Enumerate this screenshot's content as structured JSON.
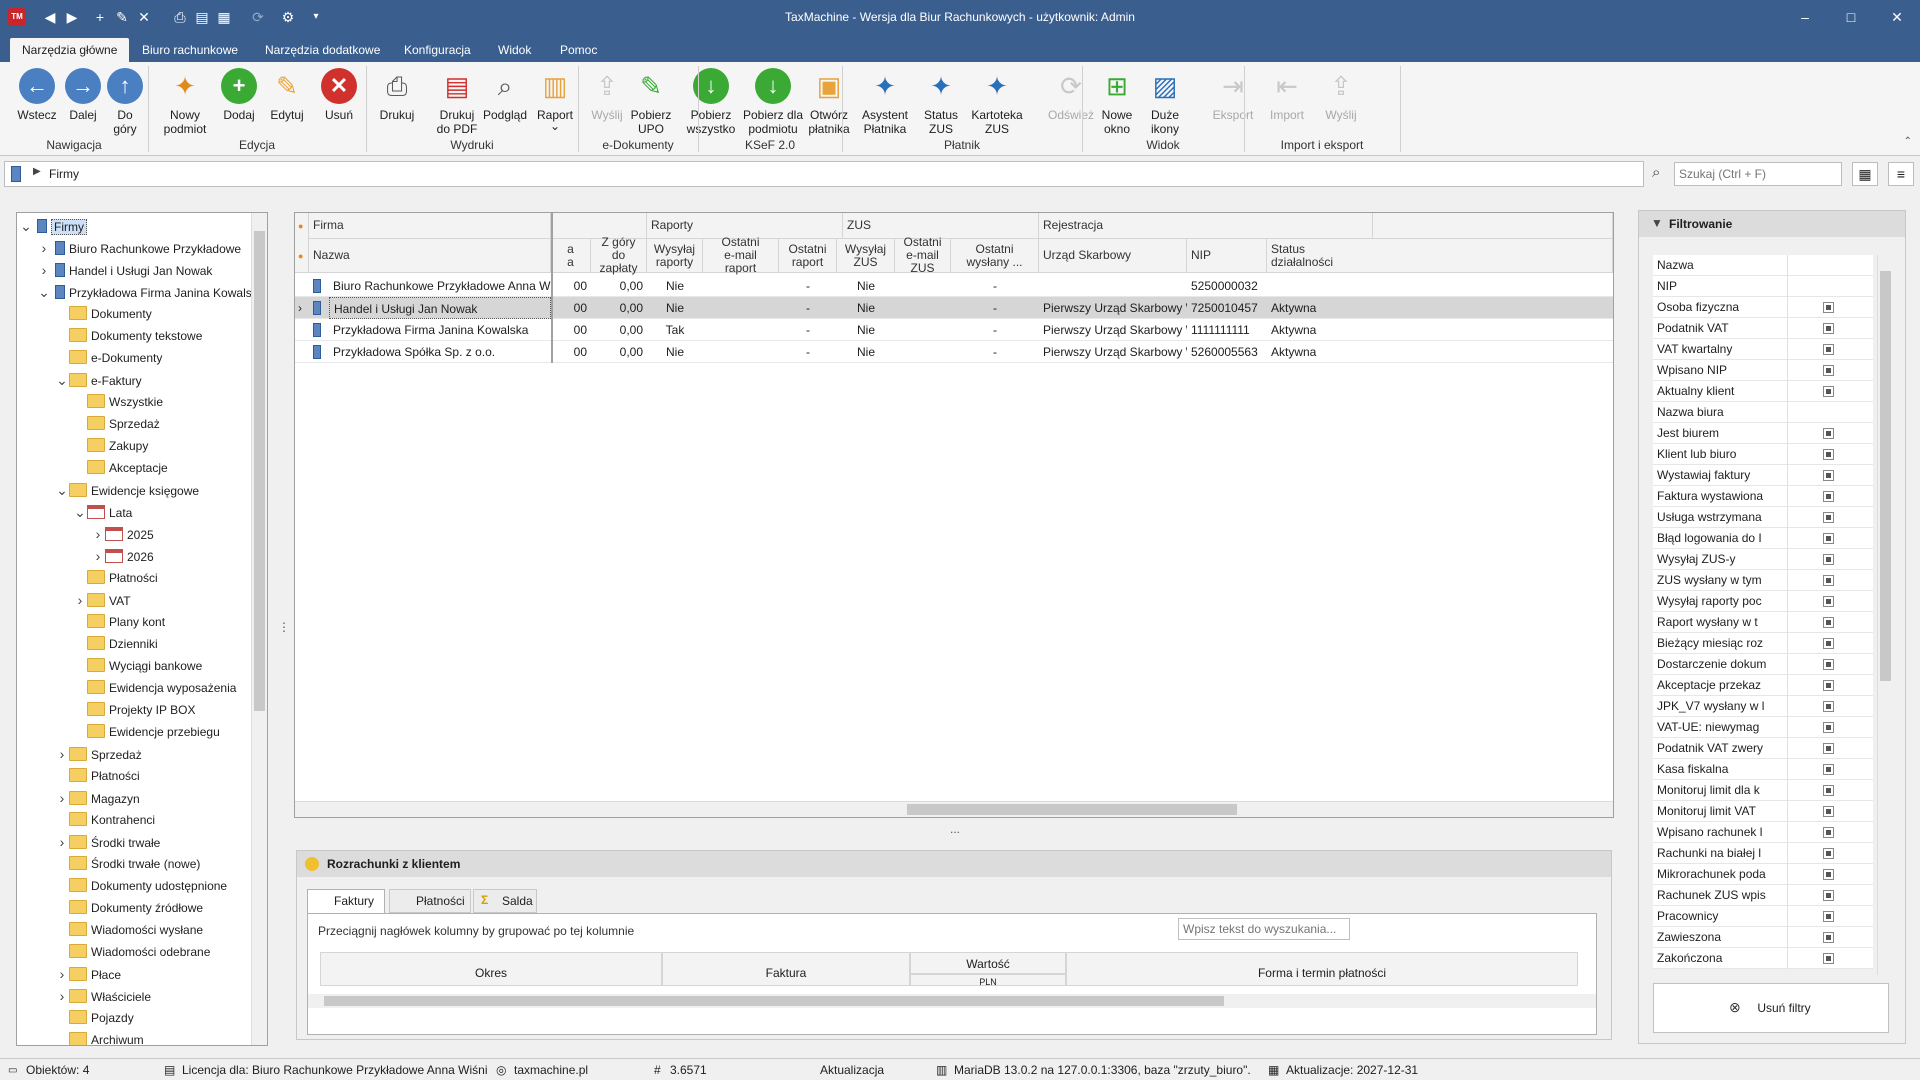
{
  "window": {
    "title": "TaxMachine  -  Wersja dla Biur Rachunkowych - użytkownik: Admin",
    "app_icon_text": "TM"
  },
  "ribbon_tabs": [
    "Narzędzia główne",
    "Biuro rachunkowe",
    "Narzędzia dodatkowe",
    "Konfiguracja",
    "Widok",
    "Pomoc"
  ],
  "ribbon": {
    "buttons": [
      {
        "label": "Wstecz",
        "icon": "arrow-left-icon",
        "color": "#4a7fc1"
      },
      {
        "label": "Dalej",
        "icon": "arrow-right-icon",
        "color": "#4a7fc1"
      },
      {
        "label": "Do\ngóry",
        "icon": "arrow-up-icon",
        "color": "#4a7fc1"
      },
      {
        "label": "Nowy\npodmiot",
        "icon": "magic-wand-icon"
      },
      {
        "label": "Dodaj",
        "icon": "plus-icon",
        "color": "#3aaa35"
      },
      {
        "label": "Edytuj",
        "icon": "pencil-icon"
      },
      {
        "label": "Usuń",
        "icon": "delete-x-icon",
        "color": "#d0312d"
      },
      {
        "label": "Drukuj",
        "icon": "printer-icon"
      },
      {
        "label": "Drukuj\ndo PDF",
        "icon": "pdf-icon"
      },
      {
        "label": "Podgląd",
        "icon": "preview-icon"
      },
      {
        "label": "Raport",
        "icon": "report-icon"
      },
      {
        "label": "Wyślij",
        "icon": "send-icon",
        "disabled": true
      },
      {
        "label": "Pobierz\nUPO",
        "icon": "upo-icon"
      },
      {
        "label": "Pobierz\nwszystko",
        "icon": "download-all-icon",
        "color": "#3aaa35"
      },
      {
        "label": "Pobierz dla\npodmiotu",
        "icon": "download-entity-icon",
        "color": "#3aaa35"
      },
      {
        "label": "Otwórz\npłatnika",
        "icon": "open-folder-icon"
      },
      {
        "label": "Asystent\nPłatnika",
        "icon": "wizard-icon"
      },
      {
        "label": "Status\nZUS",
        "icon": "status-zus-icon"
      },
      {
        "label": "Kartoteka\nZUS",
        "icon": "kartoteka-zus-icon"
      },
      {
        "label": "Odśwież",
        "icon": "refresh-icon",
        "disabled": true
      },
      {
        "label": "Nowe\nokno",
        "icon": "new-window-icon"
      },
      {
        "label": "Duże\nikony",
        "icon": "large-icons-icon"
      },
      {
        "label": "Eksport",
        "icon": "export-icon",
        "disabled": true
      },
      {
        "label": "Import",
        "icon": "import-icon",
        "disabled": true
      },
      {
        "label": "Wyślij",
        "icon": "send-icon",
        "disabled": true
      }
    ],
    "groups": [
      "Nawigacja",
      "Edycja",
      "Wydruki",
      "e-Dokumenty",
      "KSeF 2.0",
      "Płatnik",
      "Widok",
      "Import i eksport"
    ]
  },
  "breadcrumb": {
    "item": "Firmy"
  },
  "search": {
    "placeholder": "Szukaj (Ctrl + F)"
  },
  "tree": [
    {
      "label": "Firmy",
      "level": 0,
      "icon": "bldg",
      "exp": "v",
      "sel": true
    },
    {
      "label": "Biuro Rachunkowe Przykładowe",
      "level": 1,
      "icon": "bldg",
      "exp": ">"
    },
    {
      "label": "Handel i Usługi Jan Nowak",
      "level": 1,
      "icon": "bldg",
      "exp": ">"
    },
    {
      "label": "Przykładowa Firma Janina Kowalska",
      "level": 1,
      "icon": "bldg",
      "exp": "v"
    },
    {
      "label": "Dokumenty",
      "level": 2,
      "icon": "folder"
    },
    {
      "label": "Dokumenty tekstowe",
      "level": 2,
      "icon": "folder"
    },
    {
      "label": "e-Dokumenty",
      "level": 2,
      "icon": "folder"
    },
    {
      "label": "e-Faktury",
      "level": 2,
      "icon": "folder",
      "exp": "v"
    },
    {
      "label": "Wszystkie",
      "level": 3,
      "icon": "folder"
    },
    {
      "label": "Sprzedaż",
      "level": 3,
      "icon": "folder"
    },
    {
      "label": "Zakupy",
      "level": 3,
      "icon": "folder"
    },
    {
      "label": "Akceptacje",
      "level": 3,
      "icon": "folder"
    },
    {
      "label": "Ewidencje księgowe",
      "level": 2,
      "icon": "folder",
      "exp": "v"
    },
    {
      "label": "Lata",
      "level": 3,
      "icon": "cal",
      "exp": "v"
    },
    {
      "label": "2025",
      "level": 4,
      "icon": "cal",
      "exp": ">"
    },
    {
      "label": "2026",
      "level": 4,
      "icon": "cal",
      "exp": ">"
    },
    {
      "label": "Płatności",
      "level": 3,
      "icon": "folder"
    },
    {
      "label": "VAT",
      "level": 3,
      "icon": "folder",
      "exp": ">"
    },
    {
      "label": "Plany kont",
      "level": 3,
      "icon": "folder"
    },
    {
      "label": "Dzienniki",
      "level": 3,
      "icon": "folder"
    },
    {
      "label": "Wyciągi bankowe",
      "level": 3,
      "icon": "folder"
    },
    {
      "label": "Ewidencja wyposażenia",
      "level": 3,
      "icon": "folder"
    },
    {
      "label": "Projekty IP BOX",
      "level": 3,
      "icon": "folder"
    },
    {
      "label": "Ewidencje przebiegu",
      "level": 3,
      "icon": "folder"
    },
    {
      "label": "Sprzedaż",
      "level": 2,
      "icon": "folder",
      "exp": ">"
    },
    {
      "label": "Płatności",
      "level": 2,
      "icon": "folder"
    },
    {
      "label": "Magazyn",
      "level": 2,
      "icon": "folder",
      "exp": ">"
    },
    {
      "label": "Kontrahenci",
      "level": 2,
      "icon": "folder"
    },
    {
      "label": "Środki trwałe",
      "level": 2,
      "icon": "folder",
      "exp": ">"
    },
    {
      "label": "Środki trwałe (nowe)",
      "level": 2,
      "icon": "folder"
    },
    {
      "label": "Dokumenty udostępnione",
      "level": 2,
      "icon": "folder"
    },
    {
      "label": "Dokumenty źródłowe",
      "level": 2,
      "icon": "folder"
    },
    {
      "label": "Wiadomości wysłane",
      "level": 2,
      "icon": "folder"
    },
    {
      "label": "Wiadomości odebrane",
      "level": 2,
      "icon": "folder"
    },
    {
      "label": "Płace",
      "level": 2,
      "icon": "folder",
      "exp": ">"
    },
    {
      "label": "Właściciele",
      "level": 2,
      "icon": "folder",
      "exp": ">"
    },
    {
      "label": "Pojazdy",
      "level": 2,
      "icon": "folder"
    },
    {
      "label": "Archiwum",
      "level": 2,
      "icon": "folder"
    }
  ],
  "grid": {
    "groups": [
      "Firma",
      "Raporty",
      "ZUS",
      "Rejestracja"
    ],
    "columns": [
      "Nazwa",
      "a\na",
      "Z góry\ndo zapłaty",
      "Wysyłaj\nraporty",
      "Ostatni\ne-mail raport",
      "Ostatni\nraport",
      "Wysyłaj\nZUS",
      "Ostatni\ne-mail ZUS",
      "Ostatni\nwysłany ...",
      "Urząd Skarbowy",
      "NIP",
      "Status\ndziałalności"
    ],
    "rows": [
      [
        "Biuro Rachunkowe Przykładowe Anna Wiśnie...",
        "00",
        "0,00",
        "Nie",
        "",
        "-",
        "Nie",
        "",
        "-",
        "",
        "5250000032",
        ""
      ],
      [
        "Handel i Usługi Jan Nowak",
        "00",
        "0,00",
        "Nie",
        "",
        "-",
        "Nie",
        "",
        "-",
        "Pierwszy Urząd Skarbowy W...",
        "7250010457",
        "Aktywna"
      ],
      [
        "Przykładowa Firma Janina Kowalska",
        "00",
        "0,00",
        "Tak",
        "",
        "-",
        "Nie",
        "",
        "-",
        "Pierwszy Urząd Skarbowy W...",
        "1111111111",
        "Aktywna"
      ],
      [
        "Przykładowa Spółka Sp. z o.o.",
        "00",
        "0,00",
        "Nie",
        "",
        "-",
        "Nie",
        "",
        "-",
        "Pierwszy Urząd Skarbowy W...",
        "5260005563",
        "Aktywna"
      ]
    ],
    "selected_row": 1
  },
  "splitter_handle": "...",
  "bottom_panel": {
    "title": "Rozrachunki z klientem",
    "tabs": [
      "Faktury",
      "Płatności",
      "Salda"
    ],
    "group_hint": "Przeciągnij nagłówek kolumny by grupować po tej kolumnie",
    "search_placeholder": "Wpisz tekst do wyszukania...",
    "columns": [
      "Okres",
      "Faktura",
      "Wartość",
      "PLN",
      "Forma i termin płatności"
    ]
  },
  "filter": {
    "title": "Filtrowanie",
    "rows": [
      {
        "label": "Nazwa",
        "cb": false
      },
      {
        "label": "NIP",
        "cb": false
      },
      {
        "label": "Osoba fizyczna",
        "cb": true
      },
      {
        "label": "Podatnik VAT",
        "cb": true
      },
      {
        "label": "VAT kwartalny",
        "cb": true
      },
      {
        "label": "Wpisano NIP",
        "cb": true
      },
      {
        "label": "Aktualny klient",
        "cb": true
      },
      {
        "label": "Nazwa biura",
        "cb": false
      },
      {
        "label": "Jest biurem",
        "cb": true
      },
      {
        "label": "Klient lub biuro",
        "cb": true
      },
      {
        "label": "Wystawiaj faktury",
        "cb": true
      },
      {
        "label": "Faktura wystawiona",
        "cb": true
      },
      {
        "label": "Usługa wstrzymana",
        "cb": true
      },
      {
        "label": "Błąd logowania do I",
        "cb": true
      },
      {
        "label": "Wysyłaj ZUS-y",
        "cb": true
      },
      {
        "label": "ZUS wysłany w tym",
        "cb": true
      },
      {
        "label": "Wysyłaj raporty poc",
        "cb": true
      },
      {
        "label": "Raport wysłany w t",
        "cb": true
      },
      {
        "label": "Bieżący miesiąc roz",
        "cb": true
      },
      {
        "label": "Dostarczenie dokum",
        "cb": true
      },
      {
        "label": "Akceptacje przekaz",
        "cb": true
      },
      {
        "label": "JPK_V7 wysłany w l",
        "cb": true
      },
      {
        "label": "VAT-UE: niewymag",
        "cb": true
      },
      {
        "label": "Podatnik VAT zwery",
        "cb": true
      },
      {
        "label": "Kasa fiskalna",
        "cb": true
      },
      {
        "label": "Monitoruj limit dla k",
        "cb": true
      },
      {
        "label": "Monitoruj limit VAT",
        "cb": true
      },
      {
        "label": "Wpisano rachunek l",
        "cb": true
      },
      {
        "label": "Rachunki na białej l",
        "cb": true
      },
      {
        "label": "Mikrorachunek poda",
        "cb": true
      },
      {
        "label": "Rachunek ZUS wpis",
        "cb": true
      },
      {
        "label": "Pracownicy",
        "cb": true
      },
      {
        "label": "Zawieszona",
        "cb": true
      },
      {
        "label": "Zakończona",
        "cb": true
      }
    ],
    "clear_label": "Usuń filtry"
  },
  "statusbar": {
    "objects": "Obiektów: 4",
    "license": "Licencja dla: Biuro Rachunkowe Przykładowe Anna Wiśni",
    "website": "taxmachine.pl",
    "version": "3.6571",
    "update": "Aktualizacja",
    "db": "MariaDB 13.0.2 na 127.0.0.1:3306, baza \"zrzuty_biuro\".",
    "updates_until": "Aktualizacje: 2027-12-31"
  }
}
